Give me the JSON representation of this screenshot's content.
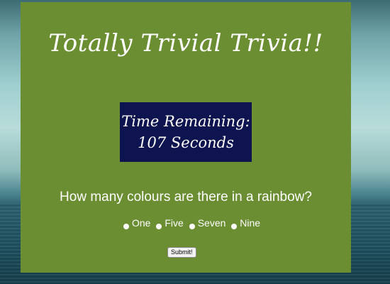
{
  "page": {
    "title": "Totally Trivial Trivia!!",
    "panel_color": "#6b8e32"
  },
  "timer": {
    "line1": "Time Remaining:",
    "line2": "107 Seconds",
    "background": "#0e1450"
  },
  "quiz": {
    "question": "How many colours are there in a rainbow?",
    "options": [
      {
        "label": "One"
      },
      {
        "label": "Five"
      },
      {
        "label": "Seven"
      },
      {
        "label": "Nine"
      }
    ],
    "submit_label": "Submit!"
  }
}
